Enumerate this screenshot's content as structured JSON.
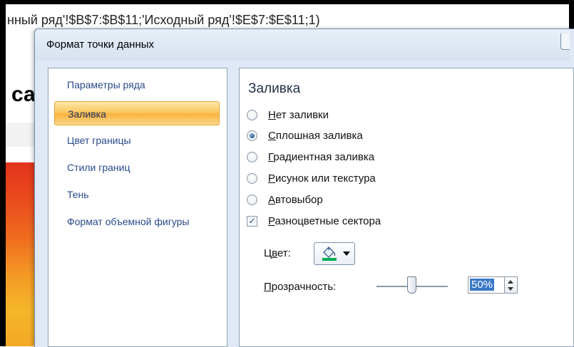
{
  "background": {
    "formula_text": "нный ряд'!$B$7:$B$11;'Исходный ряд'!$E$7:$E$11;1)",
    "sheet_title_fragment": "са ,"
  },
  "dialog": {
    "title": "Формат точки данных"
  },
  "sidebar": {
    "items": [
      {
        "label": "Параметры ряда",
        "selected": false
      },
      {
        "label": "Заливка",
        "selected": true
      },
      {
        "label": "Цвет границы",
        "selected": false
      },
      {
        "label": "Стили границ",
        "selected": false
      },
      {
        "label": "Тень",
        "selected": false
      },
      {
        "label": "Формат объемной фигуры",
        "selected": false
      }
    ]
  },
  "panel": {
    "section_title": "Заливка",
    "options": [
      {
        "type": "radio",
        "accel": "Н",
        "rest": "ет заливки",
        "checked": false
      },
      {
        "type": "radio",
        "accel": "С",
        "rest": "плошная заливка",
        "checked": true
      },
      {
        "type": "radio",
        "accel": "Г",
        "rest": "радиентная заливка",
        "checked": false
      },
      {
        "type": "radio",
        "accel": "Р",
        "rest": "исунок или текстура",
        "checked": false
      },
      {
        "type": "radio",
        "accel": "А",
        "rest": "втовыбор",
        "checked": false
      },
      {
        "type": "checkbox",
        "accel": "Р",
        "rest": "азноцветные сектора",
        "checked": true
      }
    ],
    "color": {
      "label_pre": "Ц",
      "label_accel": "в",
      "label_post": "ет:",
      "icon": "paint-bucket-icon",
      "swatch_color": "#00b050"
    },
    "transparency": {
      "label_pre": "",
      "label_accel": "П",
      "label_post": "розрачность:",
      "value": "50%",
      "level": 0.5
    }
  },
  "colors": {
    "selected_item_fill": "#fbc860",
    "sidebar_text": "#2a4a8a",
    "dialog_bg": "#dfe8f4"
  }
}
